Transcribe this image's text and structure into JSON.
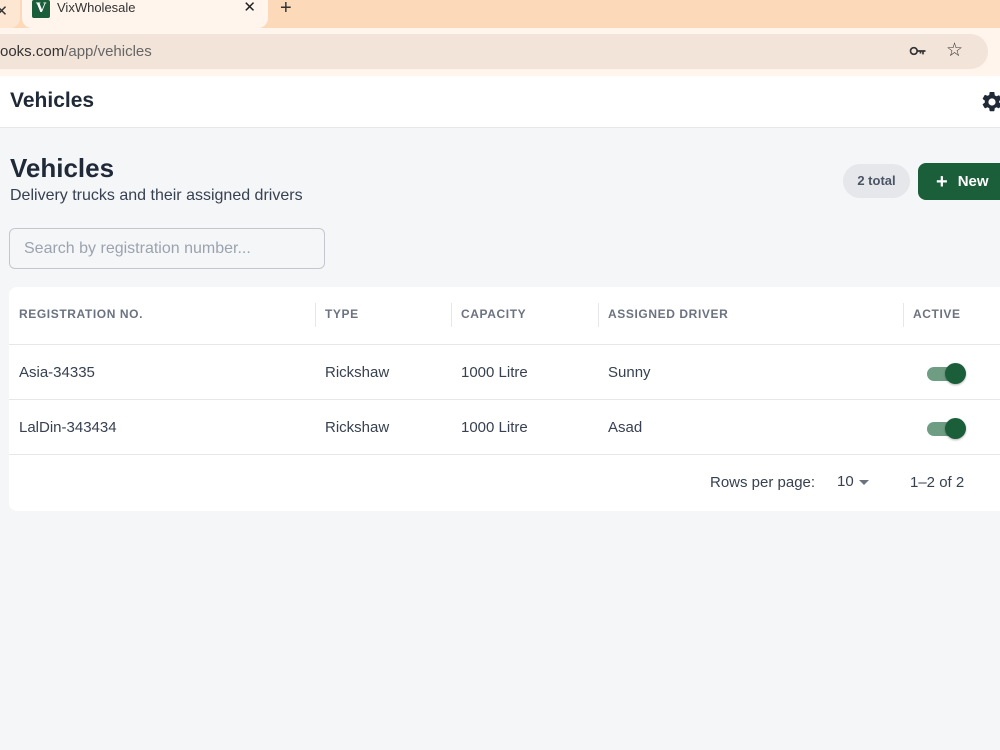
{
  "browser": {
    "tab_title": "VixWholesale",
    "favicon_letter": "V",
    "url_host": "ooks.com",
    "url_path": "/app/vehicles"
  },
  "appbar": {
    "title": "Vehicles"
  },
  "page": {
    "title": "Vehicles",
    "subtitle": "Delivery trucks and their assigned drivers",
    "total_badge": "2 total",
    "new_button_label": "New"
  },
  "search": {
    "placeholder": "Search by registration number...",
    "value": ""
  },
  "table": {
    "columns": [
      "REGISTRATION NO.",
      "TYPE",
      "CAPACITY",
      "ASSIGNED DRIVER",
      "ACTIVE"
    ],
    "rows": [
      {
        "registration": "Asia-34335",
        "type": "Rickshaw",
        "capacity": "1000 Litre",
        "driver": "Sunny",
        "active": true
      },
      {
        "registration": "LalDin-343434",
        "type": "Rickshaw",
        "capacity": "1000 Litre",
        "driver": "Asad",
        "active": true
      }
    ]
  },
  "pagination": {
    "rows_per_page_label": "Rows per page:",
    "rows_per_page_value": "10",
    "range_label": "1–2 of 2"
  },
  "colors": {
    "brand": "#1b5e3a",
    "tab_strip": "#fbd9b9"
  },
  "icons": {
    "tab_close": "close-icon",
    "new_tab": "plus-icon",
    "password": "key-icon",
    "bookmark": "star-icon",
    "settings": "gear-icon",
    "add": "plus-icon"
  }
}
